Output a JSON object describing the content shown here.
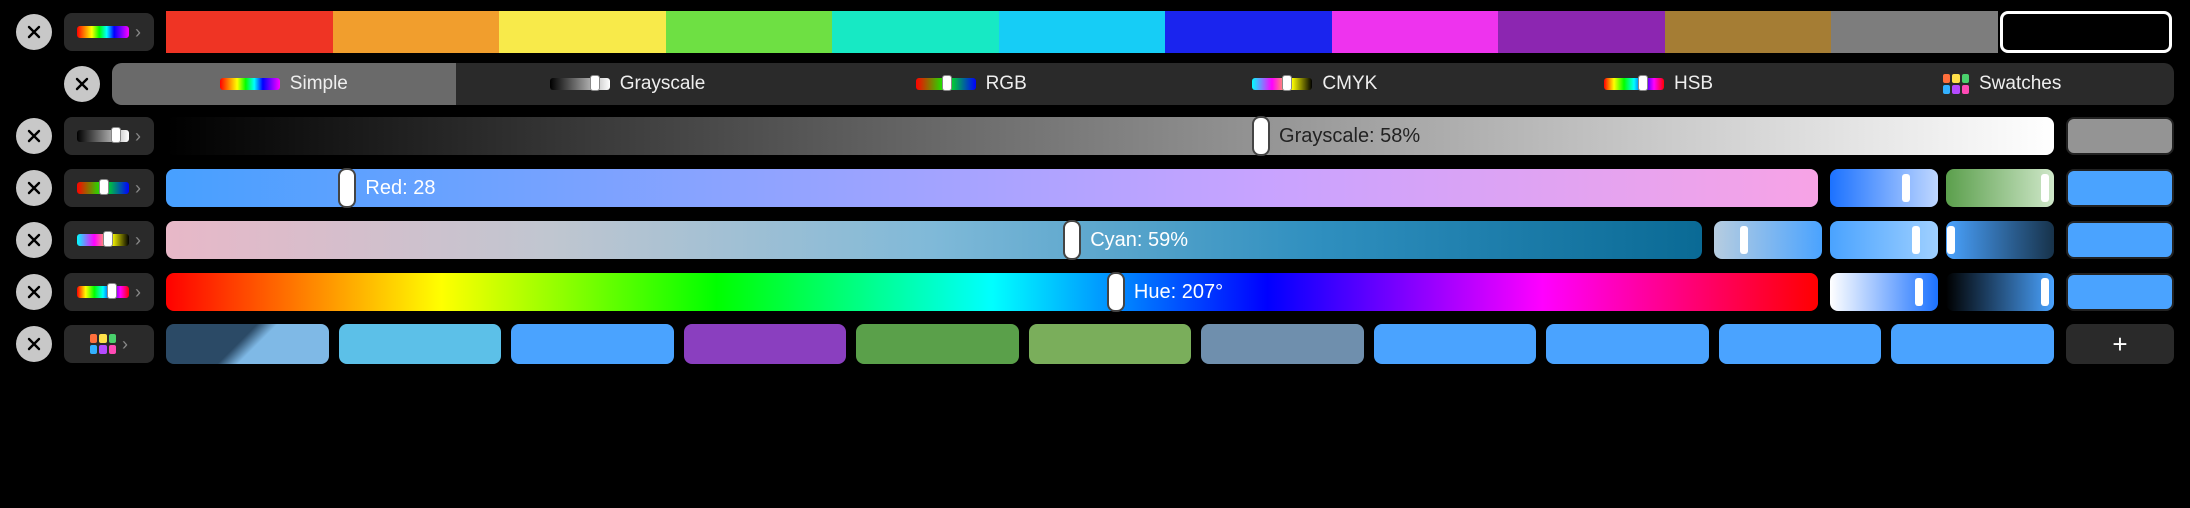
{
  "tabs": {
    "simple": "Simple",
    "grayscale": "Grayscale",
    "rgb": "RGB",
    "cmyk": "CMYK",
    "hsb": "HSB",
    "swatches": "Swatches"
  },
  "simple_colors": [
    "#ef3424",
    "#f19e2d",
    "#f8ea4a",
    "#6ee043",
    "#17e9c4",
    "#16cdf6",
    "#1a24ee",
    "#ee33ee",
    "#8c26b1",
    "#a57d34",
    "#7d7d7d",
    "#000000"
  ],
  "simple_selected_index": 11,
  "grayscale": {
    "label": "Grayscale: 58%",
    "value": 58,
    "preview": "#949494"
  },
  "rgb": {
    "label": "Red: 28",
    "red": 28,
    "mini": [
      {
        "grad": "linear-gradient(90deg,#1c72ff,#bfd7ff)",
        "thumb": 70
      },
      {
        "grad": "linear-gradient(90deg,#5b9f4c,#cfe7c9)",
        "thumb": 92
      }
    ],
    "preview": "#4aa3ff"
  },
  "cmyk": {
    "label": "Cyan: 59%",
    "cyan": 59,
    "mini": [
      {
        "grad": "linear-gradient(90deg,#b7cde0,#4aa3ff)",
        "thumb": 28
      },
      {
        "grad": "linear-gradient(90deg,#4aa3ff,#9fd0ff)",
        "thumb": 80
      },
      {
        "grad": "linear-gradient(90deg,#4aa3ff,#17324a)",
        "thumb": 5
      }
    ],
    "preview": "#4aa3ff"
  },
  "hsb": {
    "label": "Hue: 207°",
    "hue": 207,
    "mini": [
      {
        "grad": "linear-gradient(90deg,#ffffff,#1c72ff)",
        "thumb": 82
      },
      {
        "grad": "linear-gradient(90deg,#000000,#4aa3ff)",
        "thumb": 92
      }
    ],
    "preview": "#4aa3ff"
  },
  "swatches": {
    "colors": [
      "linear-gradient(135deg,#2b4a66 45%,#7fb9e6 55%)",
      "#5cc0e8",
      "#4aa3ff",
      "#8a3fbf",
      "#5aa04a",
      "#7aae5b",
      "#6f8fad",
      "#4aa3ff",
      "#4aa3ff",
      "#4aa3ff",
      "#4aa3ff"
    ],
    "add": "+"
  },
  "tab_icon_colors": {
    "swatches": [
      "#ff6f3c",
      "#ffe14a",
      "#4ad06c",
      "#33b1ff",
      "#b54aff",
      "#ff4ab5"
    ]
  }
}
